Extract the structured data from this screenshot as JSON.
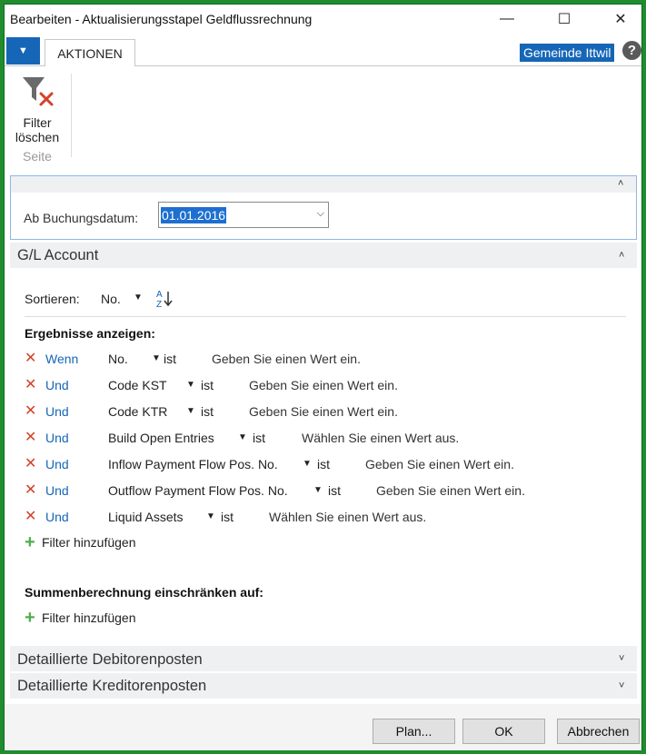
{
  "window": {
    "title": "Bearbeiten - Aktualisierungsstapel Geldflussrechnung",
    "minimize_icon": "minimize-icon",
    "maximize_icon": "maximize-icon",
    "close_icon": "close-icon"
  },
  "ribbon_bar": {
    "tab_label": "AKTIONEN",
    "company": "Gemeinde Ittwil",
    "help_symbol": "?"
  },
  "ribbon": {
    "clear_filter_line1": "Filter",
    "clear_filter_line2": "löschen",
    "group_label": "Seite"
  },
  "date_section": {
    "label": "Ab Buchungsdatum:",
    "value": "01.01.2016"
  },
  "gl_section": {
    "title": "G/L Account",
    "sort_label": "Sortieren:",
    "sort_value": "No.",
    "results_label": "Ergebnisse anzeigen:",
    "filters": [
      {
        "conj": "Wenn",
        "field": "No.",
        "op": "ist",
        "placeholder": "Geben Sie einen Wert ein."
      },
      {
        "conj": "Und",
        "field": "Code KST",
        "op": "ist",
        "placeholder": "Geben Sie einen Wert ein."
      },
      {
        "conj": "Und",
        "field": "Code KTR",
        "op": "ist",
        "placeholder": "Geben Sie einen Wert ein."
      },
      {
        "conj": "Und",
        "field": "Build Open Entries",
        "op": "ist",
        "placeholder": "Wählen Sie einen Wert aus."
      },
      {
        "conj": "Und",
        "field": "Inflow Payment Flow Pos. No.",
        "op": "ist",
        "placeholder": "Geben Sie einen Wert ein."
      },
      {
        "conj": "Und",
        "field": "Outflow Payment Flow Pos. No.",
        "op": "ist",
        "placeholder": "Geben Sie einen Wert ein."
      },
      {
        "conj": "Und",
        "field": "Liquid Assets",
        "op": "ist",
        "placeholder": "Wählen Sie einen Wert aus."
      }
    ],
    "add_filter": "Filter hinzufügen",
    "totals_label": "Summenberechnung einschränken auf:",
    "add_filter_totals": "Filter hinzufügen"
  },
  "collapsed_sections": [
    {
      "title": "Detaillierte Debitorenposten"
    },
    {
      "title": "Detaillierte Kreditorenposten"
    }
  ],
  "buttons": {
    "plan": "Plan...",
    "ok": "OK",
    "cancel": "Abbrechen"
  }
}
